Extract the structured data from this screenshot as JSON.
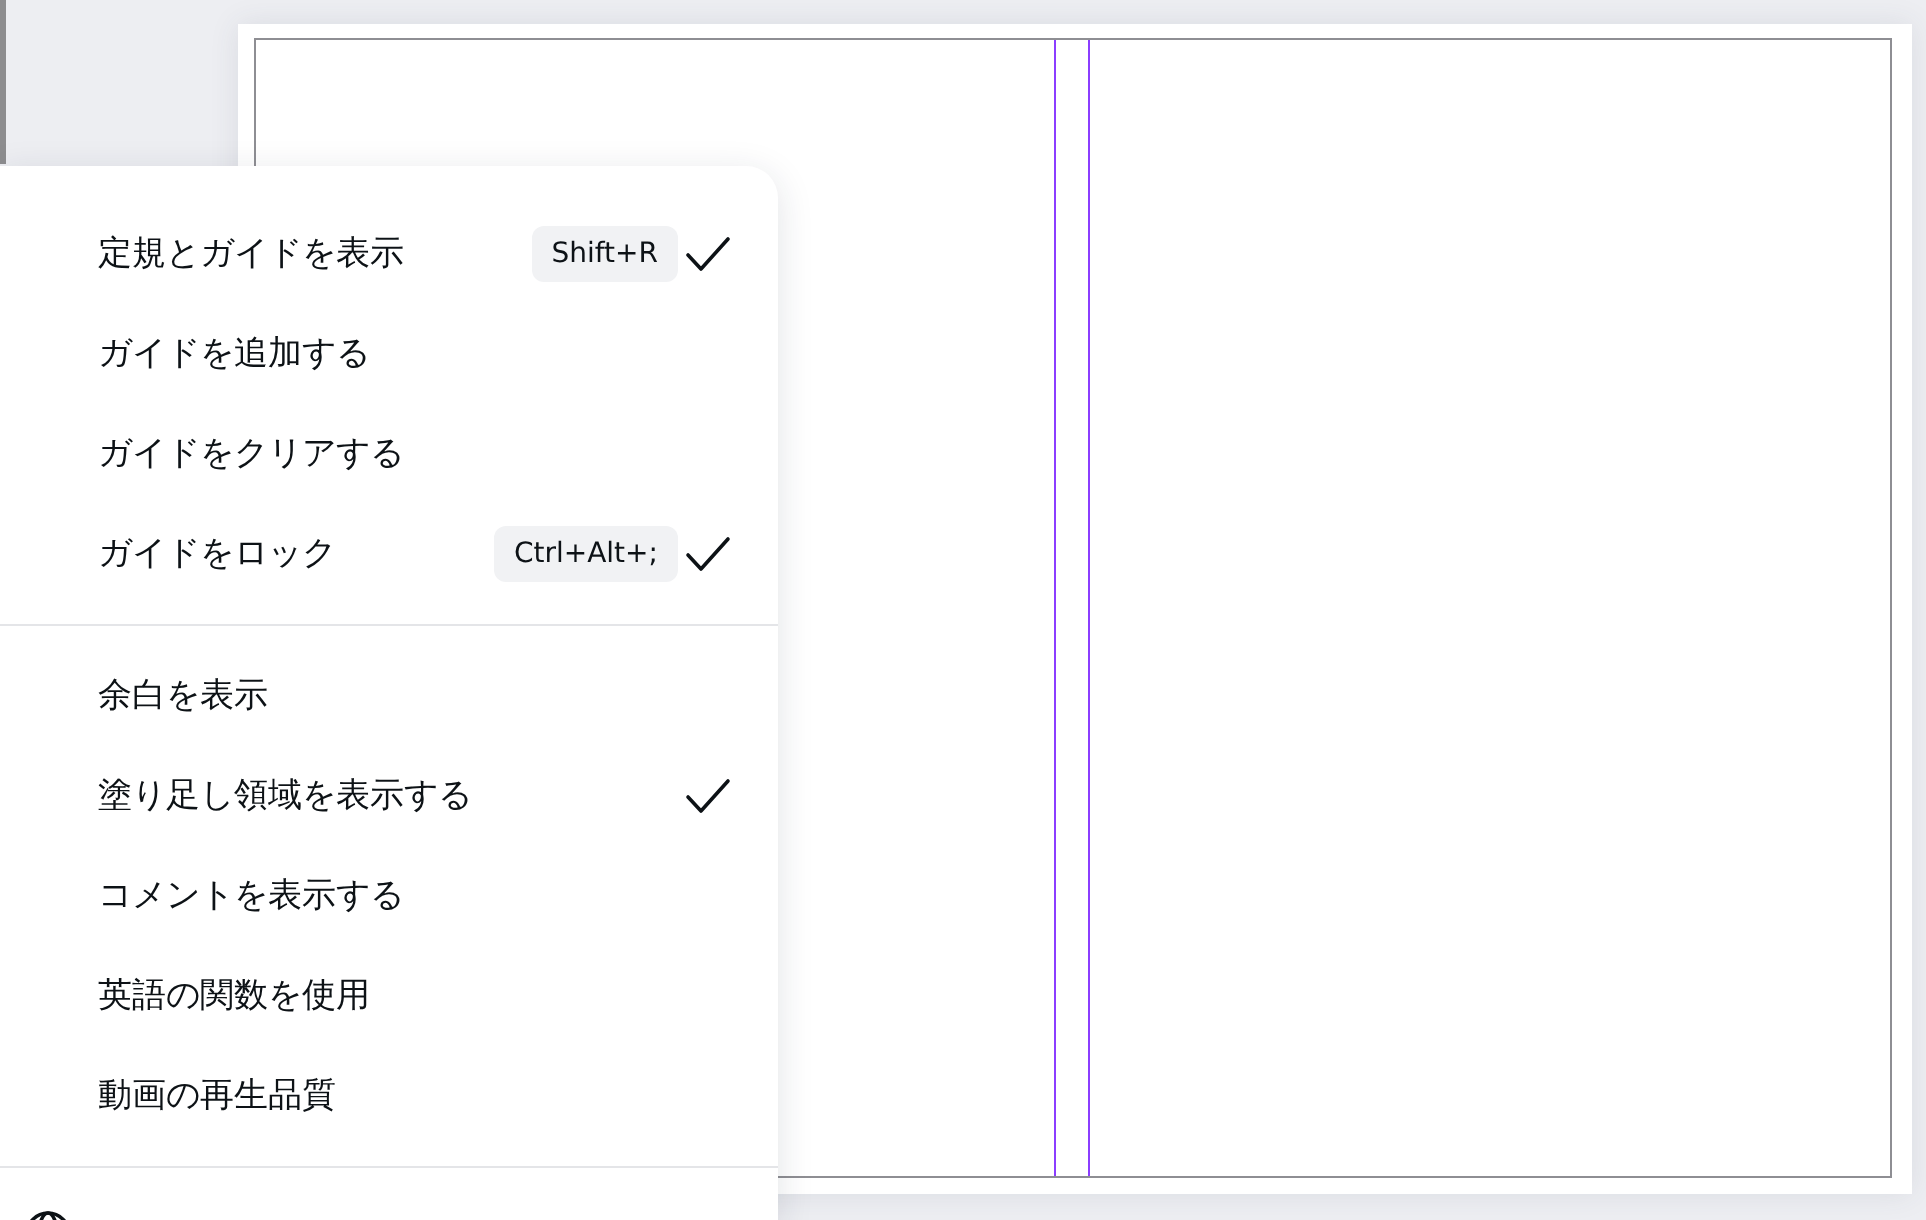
{
  "menu": {
    "sections": [
      {
        "items": [
          {
            "kind": "option",
            "label": "定規とガイドを表示",
            "shortcut": "Shift+R",
            "checked": true
          },
          {
            "kind": "option",
            "label": "ガイドを追加する",
            "checked": false
          },
          {
            "kind": "option",
            "label": "ガイドをクリアする",
            "checked": false
          },
          {
            "kind": "option",
            "label": "ガイドをロック",
            "shortcut": "Ctrl+Alt+;",
            "checked": true
          }
        ]
      },
      {
        "items": [
          {
            "kind": "option",
            "label": "余白を表示",
            "checked": false
          },
          {
            "kind": "option",
            "label": "塗り足し領域を表示する",
            "checked": true
          },
          {
            "kind": "option",
            "label": "コメントを表示する",
            "checked": false
          },
          {
            "kind": "option",
            "label": "英語の関数を使用",
            "checked": false
          },
          {
            "kind": "option",
            "label": "動画の再生品質",
            "checked": false
          }
        ]
      },
      {
        "items": [
          {
            "kind": "setting"
          }
        ]
      }
    ]
  }
}
